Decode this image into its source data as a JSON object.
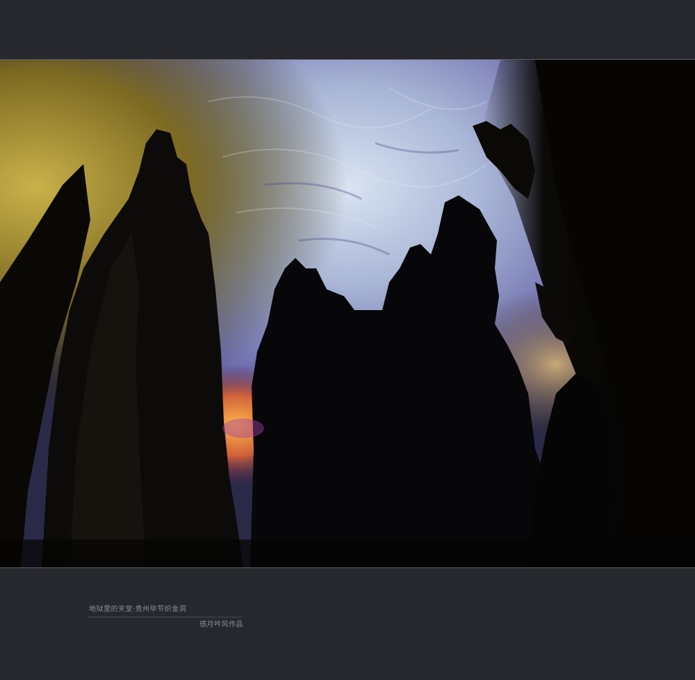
{
  "caption": {
    "title": "地狱里的天堂·贵州毕节织金洞",
    "author": "感月吟风作品"
  },
  "photo": {
    "subject_icon": "cave-photo-icon"
  },
  "colors": {
    "background": "#27282d",
    "frame_line": "#5a5c63",
    "caption_text": "#8d8f96"
  }
}
